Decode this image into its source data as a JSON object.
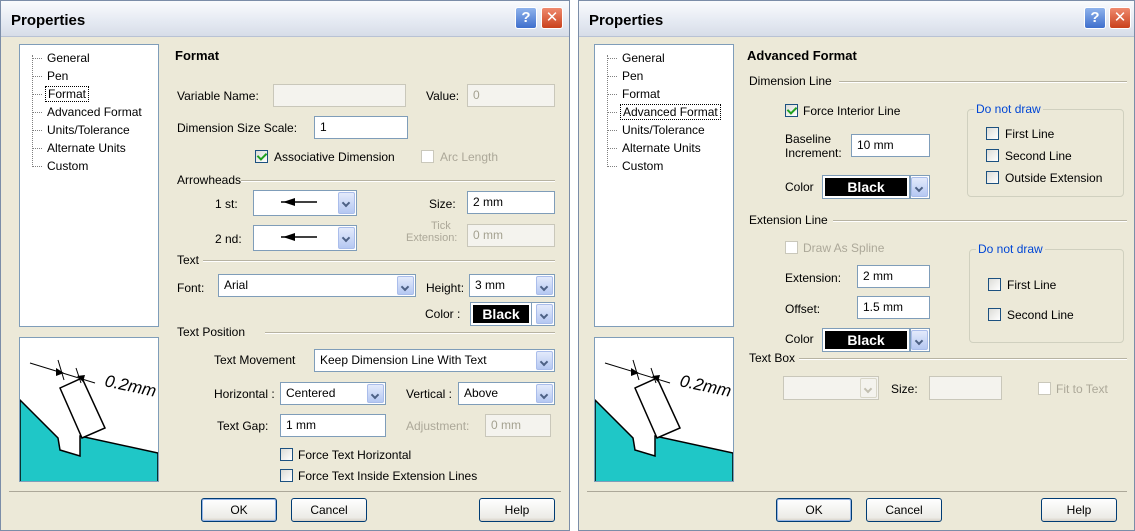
{
  "left_dialog": {
    "title": "Properties",
    "help_glyph": "?",
    "close_glyph": "✕",
    "tree": [
      "General",
      "Pen",
      "Format",
      "Advanced Format",
      "Units/Tolerance",
      "Alternate Units",
      "Custom"
    ],
    "selected_tree_item": "Format",
    "section_title": "Format",
    "variable_name_label": "Variable Name:",
    "variable_name_value": "",
    "value_label": "Value:",
    "value_value": "0",
    "dimension_size_scale_label": "Dimension Size Scale:",
    "dimension_size_scale_value": "1",
    "associative_dimension_label": "Associative Dimension",
    "associative_dimension_checked": true,
    "arc_length_label": "Arc Length",
    "arc_length_checked": false,
    "arrowheads_group": "Arrowheads",
    "first_label": "1 st:",
    "second_label": "2 nd:",
    "size_label": "Size:",
    "size_value": "2 mm",
    "tick_extension_label_1": "Tick",
    "tick_extension_label_2": "Extension:",
    "tick_extension_value": "0 mm",
    "text_group": "Text",
    "font_label": "Font:",
    "font_value": "Arial",
    "height_label": "Height:",
    "height_value": "3 mm",
    "color_label": "Color :",
    "color_value": "Black",
    "text_position_group": "Text Position",
    "text_movement_label": "Text Movement",
    "text_movement_value": "Keep Dimension Line With Text",
    "horizontal_label": "Horizontal :",
    "horizontal_value": "Centered",
    "vertical_label": "Vertical :",
    "vertical_value": "Above",
    "text_gap_label": "Text Gap:",
    "text_gap_value": "1 mm",
    "adjustment_label": "Adjustment:",
    "adjustment_value": "0 mm",
    "force_text_horizontal_label": "Force Text Horizontal",
    "force_text_inside_label": "Force Text Inside Extension Lines",
    "preview_dim": "0.2mm",
    "ok_label": "OK",
    "cancel_label": "Cancel",
    "help_label": "Help"
  },
  "right_dialog": {
    "title": "Properties",
    "help_glyph": "?",
    "close_glyph": "✕",
    "tree": [
      "General",
      "Pen",
      "Format",
      "Advanced Format",
      "Units/Tolerance",
      "Alternate Units",
      "Custom"
    ],
    "selected_tree_item": "Advanced Format",
    "section_title": "Advanced Format",
    "dimension_line_group": "Dimension Line",
    "force_interior_line_label": "Force Interior Line",
    "force_interior_line_checked": true,
    "baseline_label_1": "Baseline",
    "baseline_label_2": "Increment:",
    "baseline_value": "10 mm",
    "color_label": "Color",
    "color_value": "Black",
    "do_not_draw_label": "Do not draw",
    "first_line_label": "First Line",
    "second_line_label": "Second Line",
    "outside_extension_label": "Outside Extension",
    "extension_line_group": "Extension Line",
    "draw_as_spline_label": "Draw As Spline",
    "extension_label": "Extension:",
    "extension_value": "2 mm",
    "offset_label": "Offset:",
    "offset_value": "1.5 mm",
    "ext_color_label": "Color",
    "ext_color_value": "Black",
    "ext_do_not_draw_label": "Do not draw",
    "ext_first_line_label": "First Line",
    "ext_second_line_label": "Second Line",
    "text_box_group": "Text Box",
    "tb_size_label": "Size:",
    "fit_to_text_label": "Fit to Text",
    "preview_dim": "0.2mm",
    "ok_label": "OK",
    "cancel_label": "Cancel",
    "help_label": "Help"
  },
  "colors": {
    "preview_fill": "#1fc7c7",
    "link_blue": "#0046d5"
  }
}
